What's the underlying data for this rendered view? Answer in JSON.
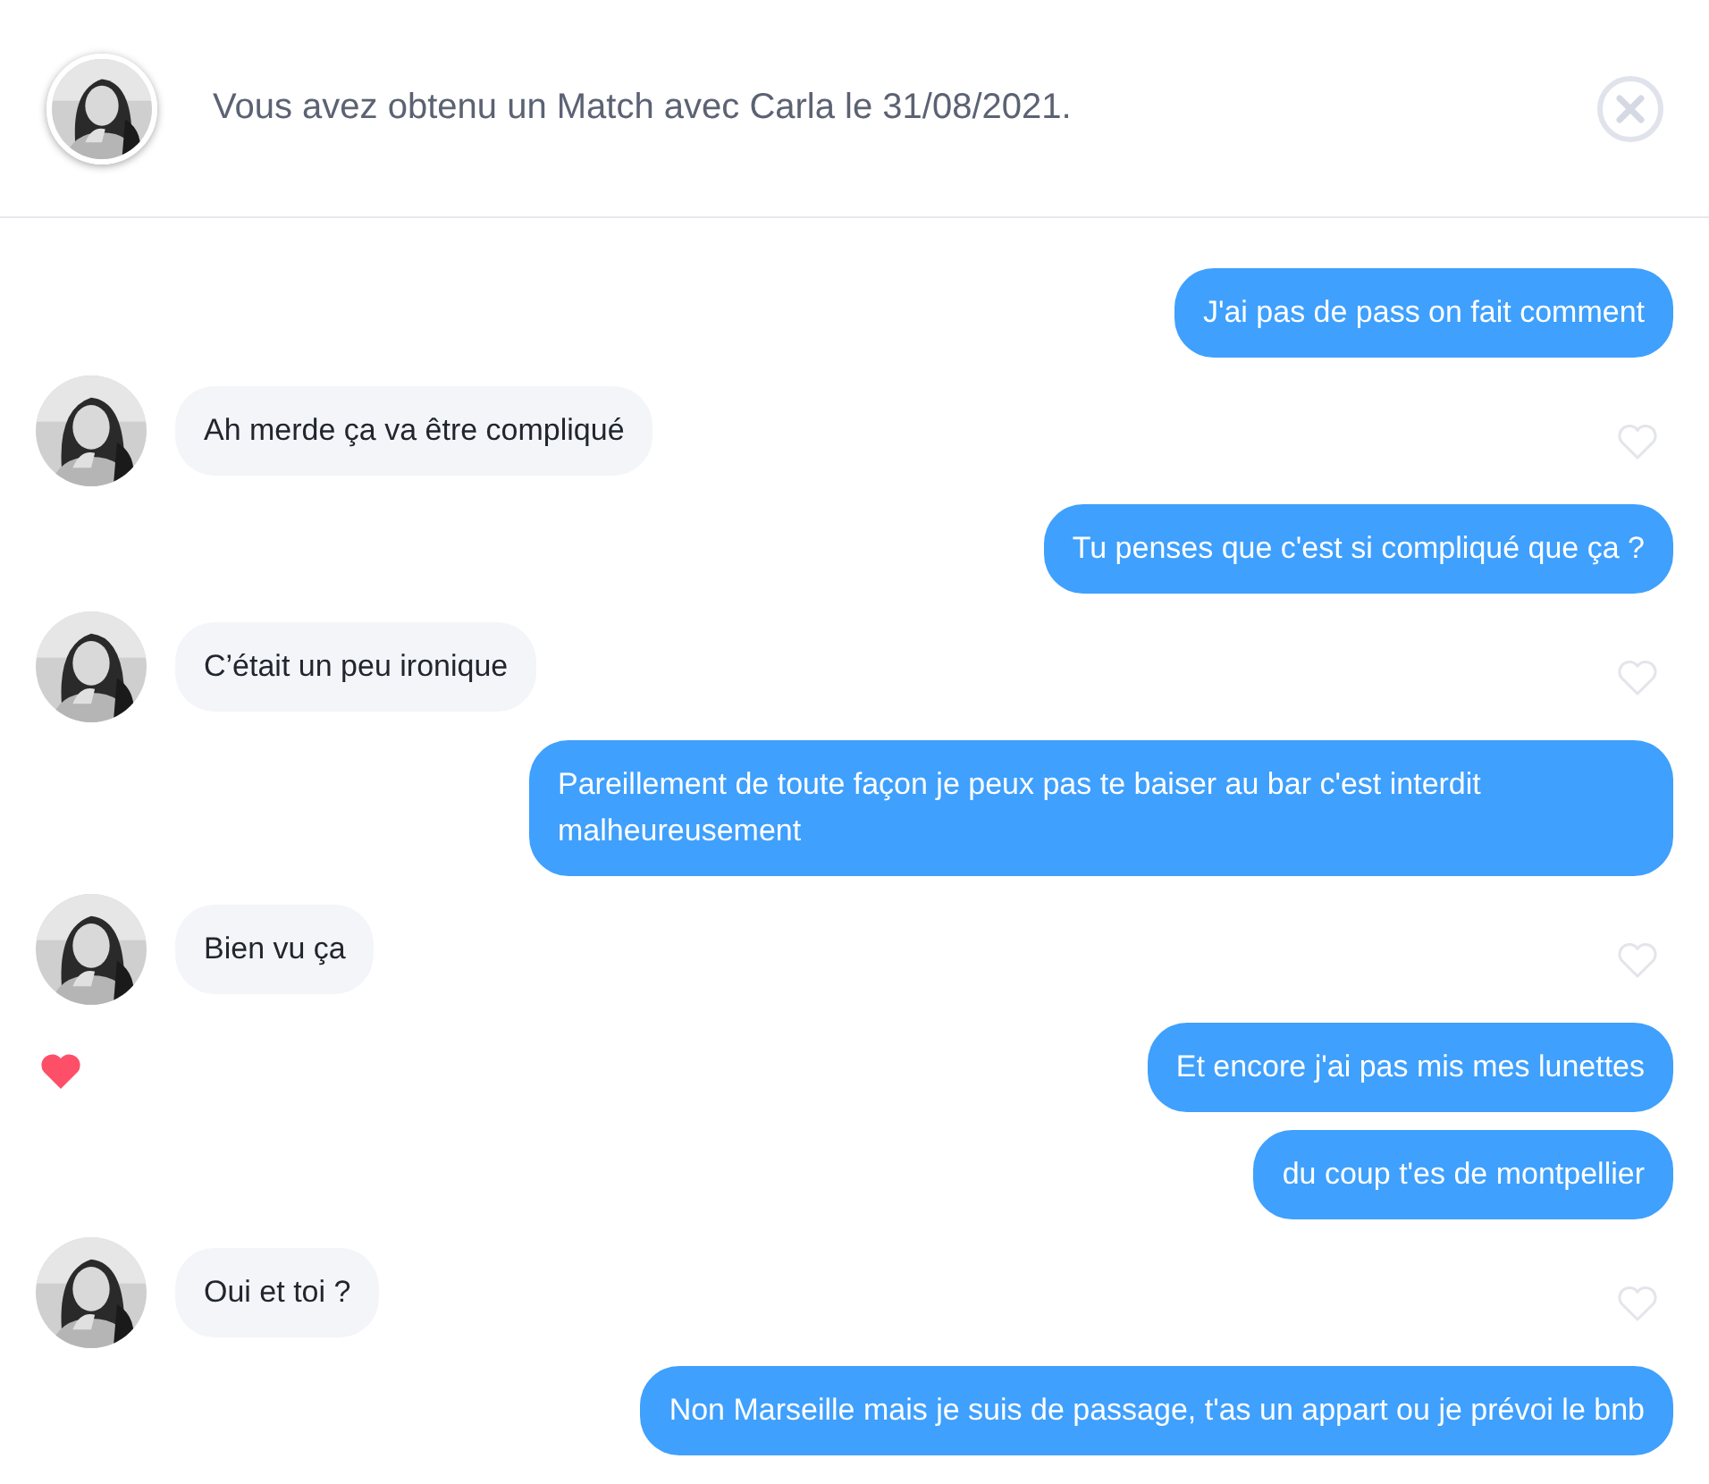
{
  "header": {
    "match_text": "Vous avez obtenu un Match avec Carla le 31/08/2021."
  },
  "messages": [
    {
      "kind": "sent",
      "text": "J'ai pas de pass on fait comment",
      "liked": false
    },
    {
      "kind": "received",
      "text": "Ah merde ça va être compliqué",
      "liked": false
    },
    {
      "kind": "sent",
      "text": "Tu penses que c'est si compliqué que ça ?",
      "liked": false
    },
    {
      "kind": "received",
      "text": "C’était un peu ironique",
      "liked": false
    },
    {
      "kind": "sent",
      "text": "Pareillement de toute façon je peux pas te baiser au bar c'est interdit malheureusement",
      "liked": false
    },
    {
      "kind": "received",
      "text": "Bien vu ça",
      "liked": false
    },
    {
      "kind": "sent",
      "text": "Et encore j'ai pas mis mes lunettes",
      "liked": true
    },
    {
      "kind": "sent",
      "text": "du coup t'es de montpellier",
      "liked": false
    },
    {
      "kind": "received",
      "text": "Oui et toi ?",
      "liked": false
    },
    {
      "kind": "sent",
      "text": "Non Marseille mais je suis de passage, t'as un appart ou je prévoi le bnb",
      "liked": false
    }
  ]
}
